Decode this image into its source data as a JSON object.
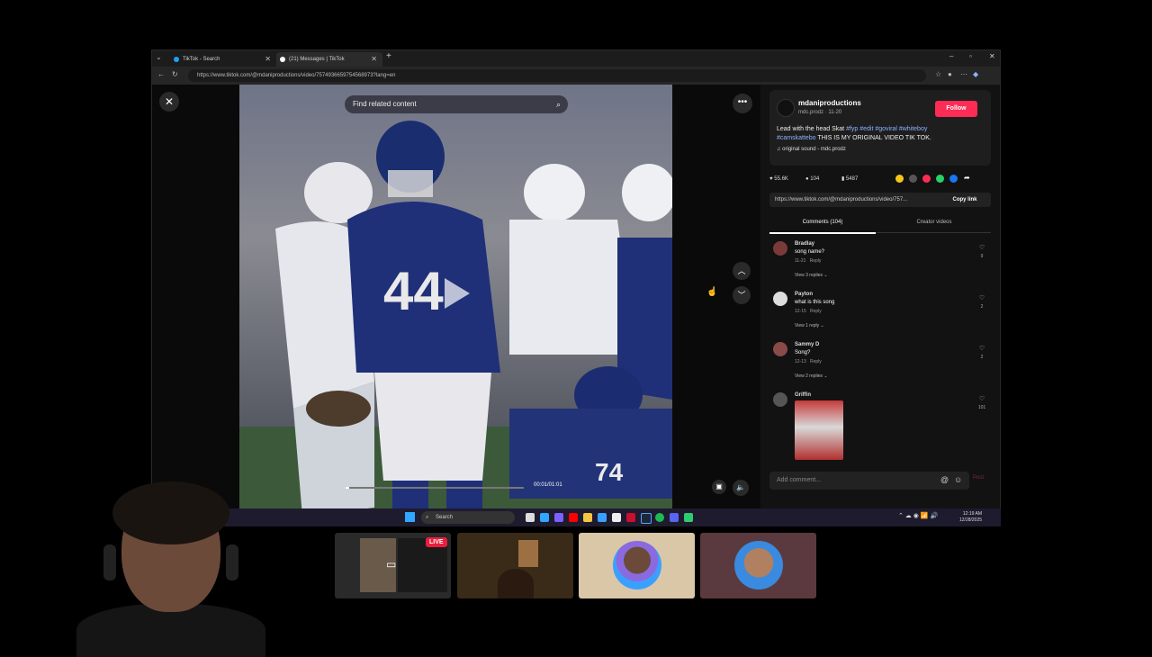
{
  "browser": {
    "tabs": [
      {
        "label": "TikTok - Search"
      },
      {
        "label": "(21) Messages | TikTok"
      }
    ],
    "new_tab": "+",
    "url": "https://www.tiktok.com/@mdaniproductions/video/7574936659754568973?lang=en"
  },
  "video": {
    "search_placeholder": "Find related content",
    "timecode": "00:01/01:01",
    "progress": 0.02
  },
  "post": {
    "author": "mdaniproductions",
    "author_meta": "mdc.prodz · 11-20",
    "follow_label": "Follow",
    "caption_text": "Lead with the head Skat ",
    "hashtags_line1": "#fyp #edit #goviral #whiteboy",
    "hashtag_line2": "#camskattebo",
    "caption_suffix": " THIS IS MY ORIGINAL VIDEO TIK TOK.",
    "sound": "original sound - mdc.prodz",
    "likes": "55.6K",
    "comments": "104",
    "saves": "5487",
    "link": "https://www.tiktok.com/@mdaniproductions/video/757...",
    "copy_link_label": "Copy link"
  },
  "panel_tabs": {
    "comments": "Comments (104)",
    "creator": "Creator videos"
  },
  "comments": [
    {
      "user": "Bradlay",
      "text": "song name?",
      "date": "11-21",
      "reply": "Reply",
      "replies": "View 3 replies",
      "likes": "9"
    },
    {
      "user": "Payton",
      "text": "what is this song",
      "date": "12-15",
      "reply": "Reply",
      "replies": "View 1 reply",
      "likes": "2"
    },
    {
      "user": "Sammy D",
      "text": "Song?",
      "date": "12-13",
      "reply": "Reply",
      "replies": "View 2 replies",
      "likes": "2"
    },
    {
      "user": "Griffin",
      "likes": "101"
    }
  ],
  "comment_input": {
    "placeholder": "Add comment...",
    "post": "Post"
  },
  "taskbar": {
    "search": "Search",
    "time": "12:19 AM",
    "date": "12/28/2025"
  },
  "call": {
    "live_badge": "LIVE"
  }
}
